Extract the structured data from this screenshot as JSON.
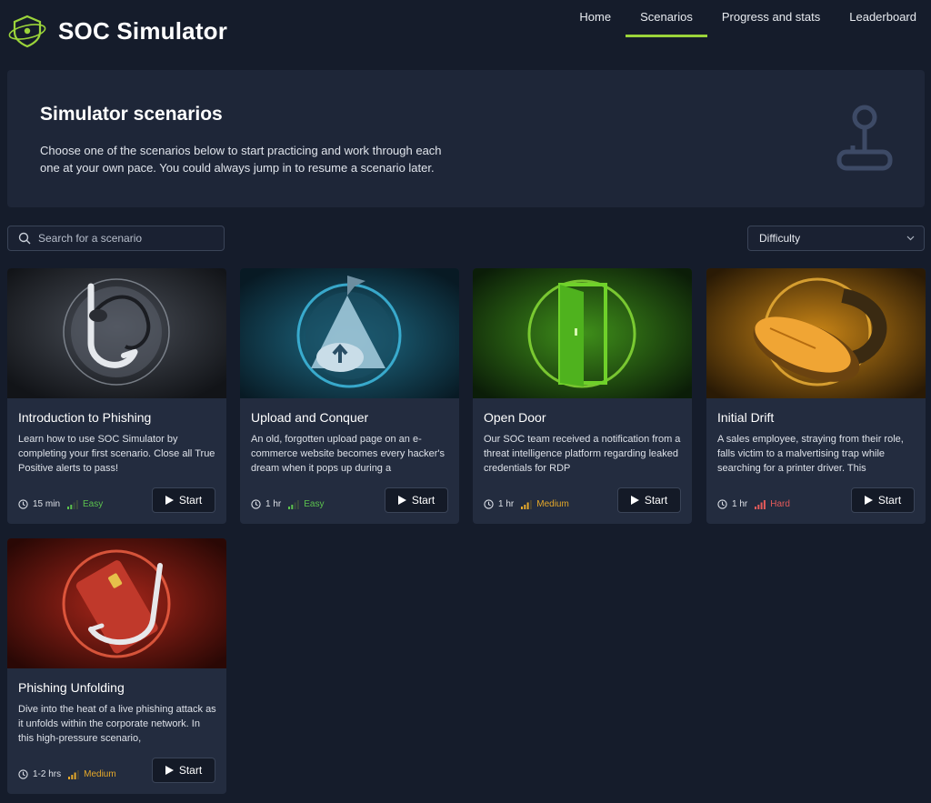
{
  "header": {
    "app_title": "SOC Simulator",
    "nav": [
      "Home",
      "Scenarios",
      "Progress and stats",
      "Leaderboard"
    ],
    "active_nav": "Scenarios"
  },
  "hero": {
    "title": "Simulator scenarios",
    "description": "Choose one of the scenarios below to start practicing and work through each one at your own pace. You could always jump in to resume a scenario later."
  },
  "search": {
    "placeholder": "Search for a scenario"
  },
  "filter": {
    "label": "Difficulty"
  },
  "scenarios": [
    {
      "title": "Introduction to Phishing",
      "description": "Learn how to use SOC Simulator by completing your first scenario. Close all True Positive alerts to pass!",
      "duration": "15 min",
      "difficulty": "Easy",
      "start_label": "Start"
    },
    {
      "title": "Upload and Conquer",
      "description": "An old, forgotten upload page on an e-commerce website becomes every hacker's dream when it pops up during a",
      "duration": "1 hr",
      "difficulty": "Easy",
      "start_label": "Start"
    },
    {
      "title": "Open Door",
      "description": "Our SOC team received a notification from a threat intelligence platform regarding leaked credentials for RDP",
      "duration": "1 hr",
      "difficulty": "Medium",
      "start_label": "Start"
    },
    {
      "title": "Initial Drift",
      "description": "A sales employee, straying from their role, falls victim to a malvertising trap while searching for a printer driver. This",
      "duration": "1 hr",
      "difficulty": "Hard",
      "start_label": "Start"
    },
    {
      "title": "Phishing Unfolding",
      "description": "Dive into the heat of a live phishing attack as it unfolds within the corporate network. In this high-pressure scenario,",
      "duration": "1-2 hrs",
      "difficulty": "Medium",
      "start_label": "Start"
    }
  ],
  "colors": {
    "accent": "#9bd43a",
    "easy": "#5cc24e",
    "medium": "#e6a92a",
    "hard": "#e45a5a"
  }
}
